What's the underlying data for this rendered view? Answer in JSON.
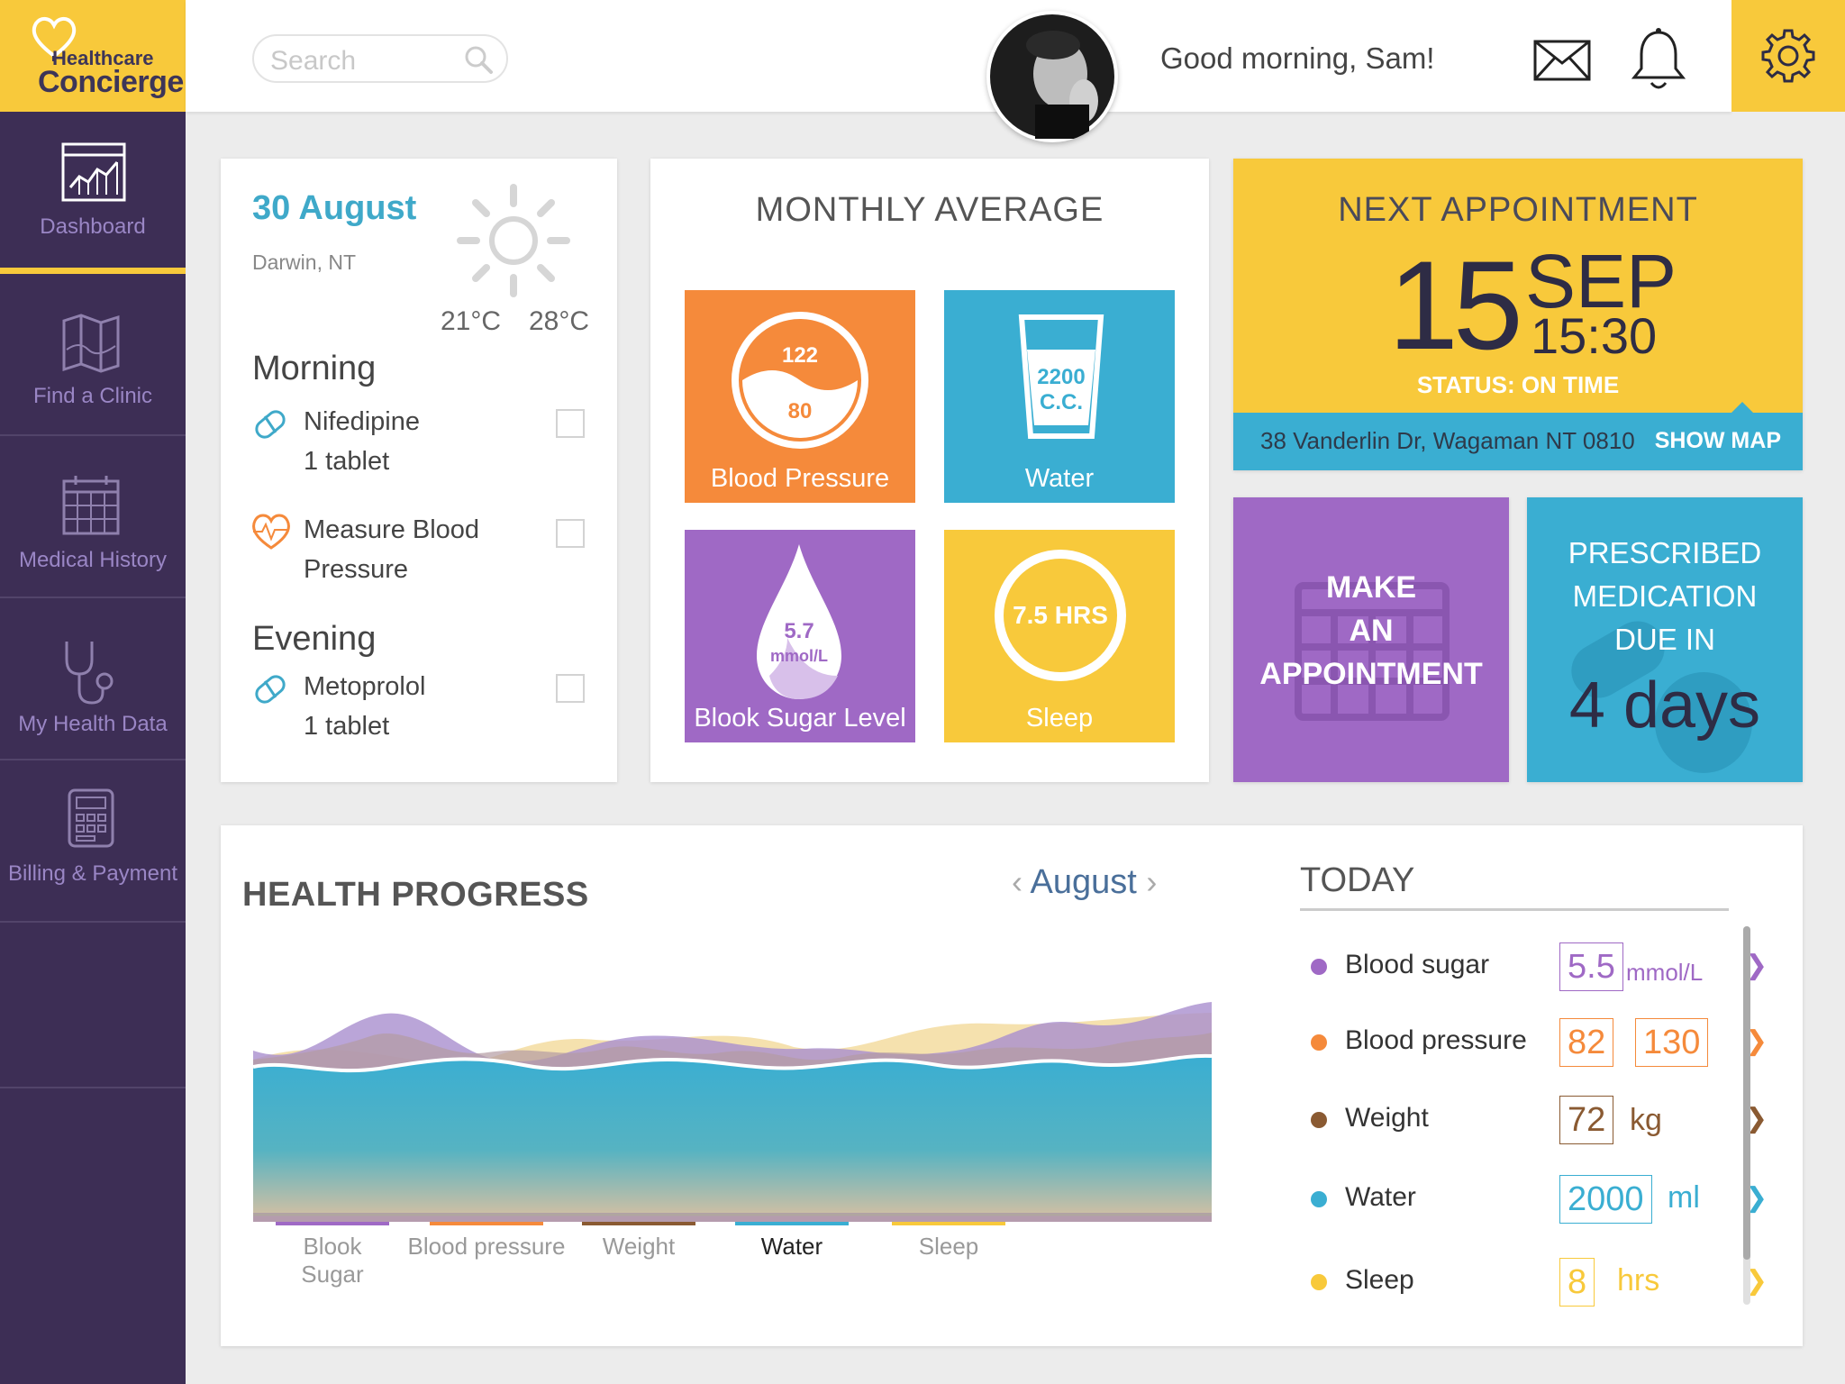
{
  "app": {
    "logo_line1": "Healthcare",
    "logo_line2": "Concierge",
    "brand_yellow": "#f8c93b",
    "brand_purple": "#3d2e55"
  },
  "header": {
    "search_placeholder": "Search",
    "greeting": "Good morning, Sam!",
    "icons": [
      "search-icon",
      "mail-icon",
      "bell-icon",
      "gear-icon"
    ]
  },
  "sidebar": {
    "items": [
      {
        "label": "Dashboard",
        "icon": "chart-icon",
        "active": true
      },
      {
        "label": "Find a Clinic",
        "icon": "map-icon"
      },
      {
        "label": "Medical History",
        "icon": "calendar-icon"
      },
      {
        "label": "My Health Data",
        "icon": "stethoscope-icon"
      },
      {
        "label": "Billing & Payment",
        "icon": "calculator-icon"
      }
    ]
  },
  "schedule": {
    "date": "30 August",
    "location": "Darwin, NT",
    "temp_low": "21°C",
    "temp_high": "28°C",
    "morning_label": "Morning",
    "evening_label": "Evening",
    "items": [
      {
        "line1": "Nifedipine",
        "line2": "1 tablet",
        "icon": "pill-icon",
        "checked": false
      },
      {
        "line1": "Measure Blood",
        "line2": "Pressure",
        "icon": "heart-pulse-icon",
        "checked": false
      },
      {
        "line1": "Metoprolol",
        "line2": "1 tablet",
        "icon": "pill-icon",
        "checked": false
      }
    ]
  },
  "monthly": {
    "title": "MONTHLY AVERAGE",
    "tiles": [
      {
        "label": "Blood Pressure",
        "value_top": "122",
        "value_bottom": "80",
        "color": "#f58a3b"
      },
      {
        "label": "Water",
        "value_top": "2200",
        "value_bottom": "C.C.",
        "color": "#3aaed2"
      },
      {
        "label": "Blook Sugar Level",
        "value_top": "5.7",
        "value_bottom": "mmol/L",
        "color": "#9f69c5"
      },
      {
        "label": "Sleep",
        "value_top": "7.5 HRS",
        "color": "#f8c93b"
      }
    ]
  },
  "appointment": {
    "title": "NEXT APPOINTMENT",
    "day": "15",
    "month": "SEP",
    "time": "15:30",
    "status": "STATUS: ON TIME",
    "address": "38 Vanderlin Dr, Wagaman NT 0810",
    "map_link": "SHOW MAP"
  },
  "make_appointment": {
    "line1": "MAKE",
    "line2": "AN",
    "line3": "APPOINTMENT"
  },
  "prescribed": {
    "line1": "PRESCRIBED",
    "line2": "MEDICATION",
    "line3": "DUE IN",
    "days": "4 days"
  },
  "health_progress": {
    "title": "HEALTH PROGRESS",
    "month": "August",
    "legend": [
      {
        "label": "Blook Sugar",
        "color": "#9f69c5",
        "active": false
      },
      {
        "label": "Blood pressure",
        "color": "#f58a3b",
        "active": false
      },
      {
        "label": "Weight",
        "color": "#8a5a32",
        "active": false
      },
      {
        "label": "Water",
        "color": "#3aaed2",
        "active": true
      },
      {
        "label": "Sleep",
        "color": "#f8c93b",
        "active": false
      }
    ]
  },
  "today": {
    "title": "TODAY",
    "rows": [
      {
        "name": "Blood sugar",
        "values": [
          "5.5"
        ],
        "unit": "mmol/L",
        "color": "#9f69c5"
      },
      {
        "name": "Blood pressure",
        "values": [
          "82",
          "130"
        ],
        "unit": "",
        "color": "#f58a3b"
      },
      {
        "name": "Weight",
        "values": [
          "72"
        ],
        "unit": "kg",
        "color": "#8a5a32"
      },
      {
        "name": "Water",
        "values": [
          "2000"
        ],
        "unit": "ml",
        "color": "#3aaed2"
      },
      {
        "name": "Sleep",
        "values": [
          "8"
        ],
        "unit": "hrs",
        "color": "#f8c93b"
      }
    ]
  }
}
